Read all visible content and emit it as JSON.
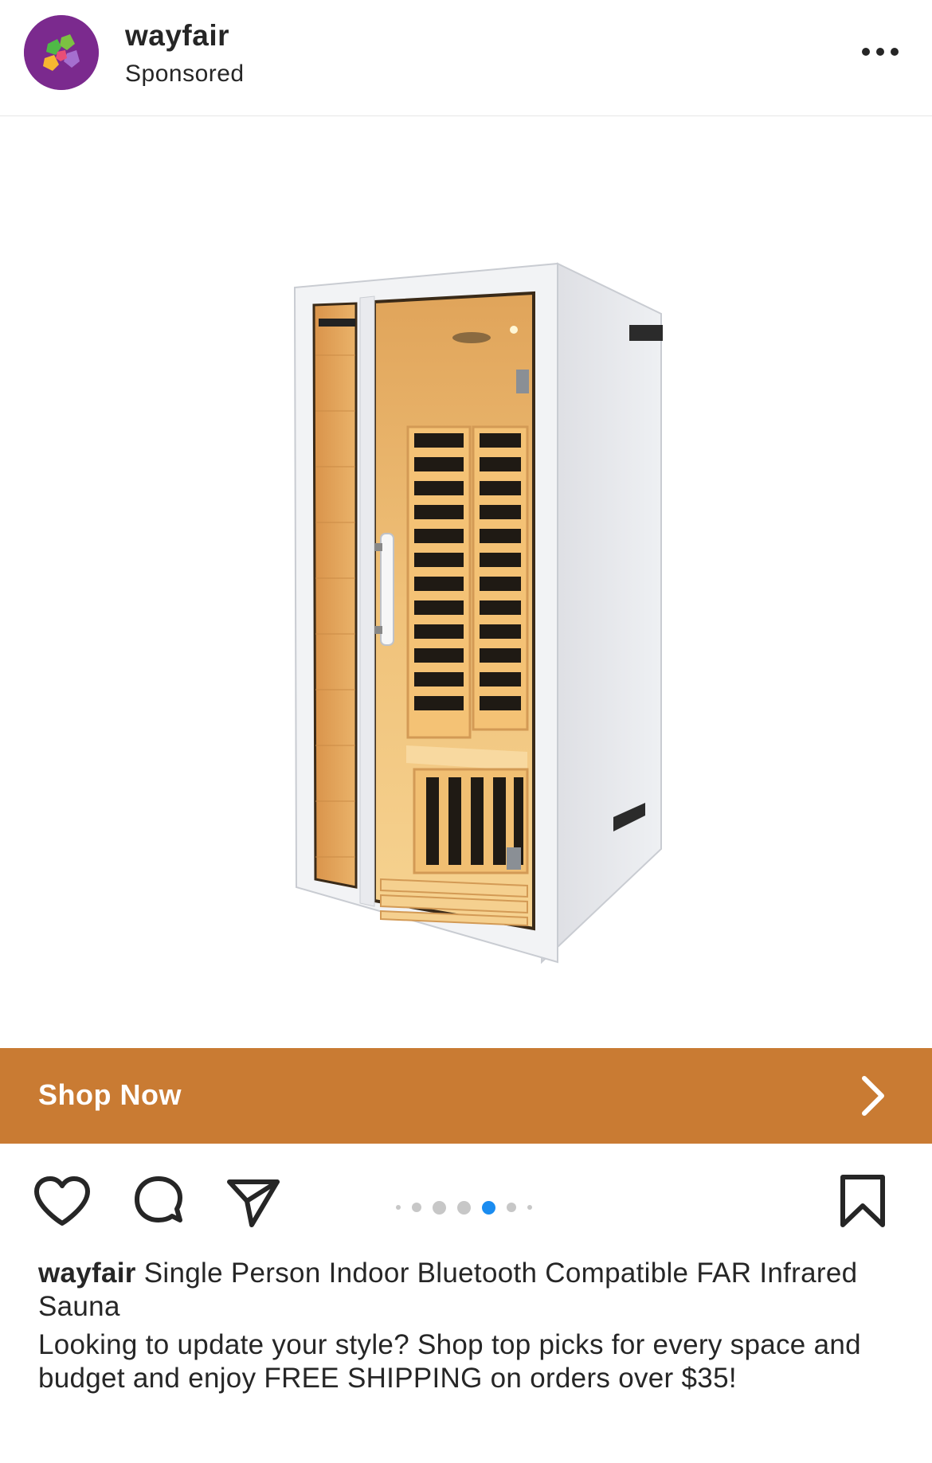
{
  "post": {
    "username": "wayfair",
    "sponsored_label": "Sponsored",
    "more_icon": "more-horizontal-icon"
  },
  "media": {
    "image_name": "product-photo-infrared-sauna",
    "carousel": {
      "total": 7,
      "active_index": 4
    }
  },
  "cta": {
    "label": "Shop Now",
    "icon": "chevron-right-icon",
    "color": "#c97b33"
  },
  "actions": {
    "like_icon": "heart-icon",
    "comment_icon": "comment-icon",
    "share_icon": "send-icon",
    "save_icon": "bookmark-icon",
    "active_dot_color": "#1a8cf0"
  },
  "caption": {
    "username": "wayfair",
    "title": "Single Person Indoor Bluetooth Compatible FAR Infrared Sauna",
    "body": "Looking to update your style? Shop top picks for every space and budget and enjoy FREE SHIPPING on orders over $35!"
  }
}
